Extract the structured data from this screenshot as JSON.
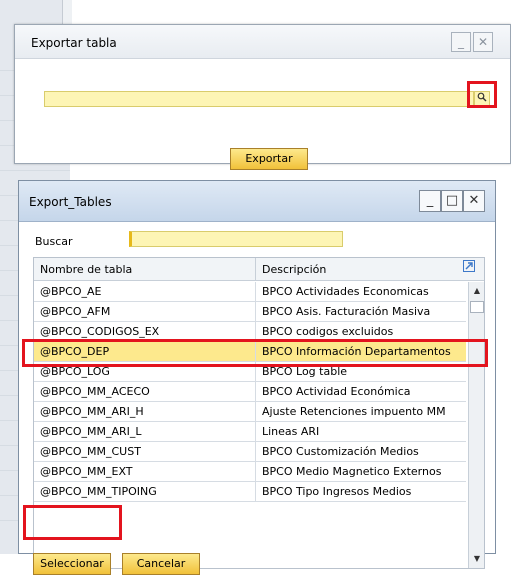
{
  "dialog_exportar": {
    "title": "Exportar tabla",
    "minimize_glyph": "_",
    "close_glyph": "✕",
    "table_input_value": "",
    "search_icon": "magnifier-icon",
    "export_button": "Exportar"
  },
  "dialog_export_tables": {
    "title": "Export_Tables",
    "minimize_glyph": "_",
    "maximize_glyph": "□",
    "close_glyph": "✕",
    "search_label": "Buscar",
    "search_value": "",
    "columns": {
      "name": "Nombre de tabla",
      "description": "Descripción"
    },
    "rows": [
      {
        "name": "@BPCO_AE",
        "description": "BPCO Actividades Economicas"
      },
      {
        "name": "@BPCO_AFM",
        "description": "BPCO Asis. Facturación Masiva"
      },
      {
        "name": "@BPCO_CODIGOS_EX",
        "description": "BPCO codigos excluidos"
      },
      {
        "name": "@BPCO_DEP",
        "description": "BPCO Información Departamentos",
        "selected": true
      },
      {
        "name": "@BPCO_LOG",
        "description": "BPCO Log table"
      },
      {
        "name": "@BPCO_MM_ACECO",
        "description": "BPCO Actividad Económica"
      },
      {
        "name": "@BPCO_MM_ARI_H",
        "description": "Ajuste Retenciones impuento MM"
      },
      {
        "name": "@BPCO_MM_ARI_L",
        "description": "Lineas ARI"
      },
      {
        "name": "@BPCO_MM_CUST",
        "description": "BPCO Customización Medios"
      },
      {
        "name": "@BPCO_MM_EXT",
        "description": "BPCO Medio Magnetico Externos"
      },
      {
        "name": "@BPCO_MM_TIPOING",
        "description": "BPCO Tipo Ingresos Medios"
      }
    ],
    "select_button": "Seleccionar",
    "cancel_button": "Cancelar"
  },
  "colors": {
    "field_yellow": "#fdf5b5",
    "selected_row": "#fde98d",
    "highlight_red": "#e3141e"
  }
}
